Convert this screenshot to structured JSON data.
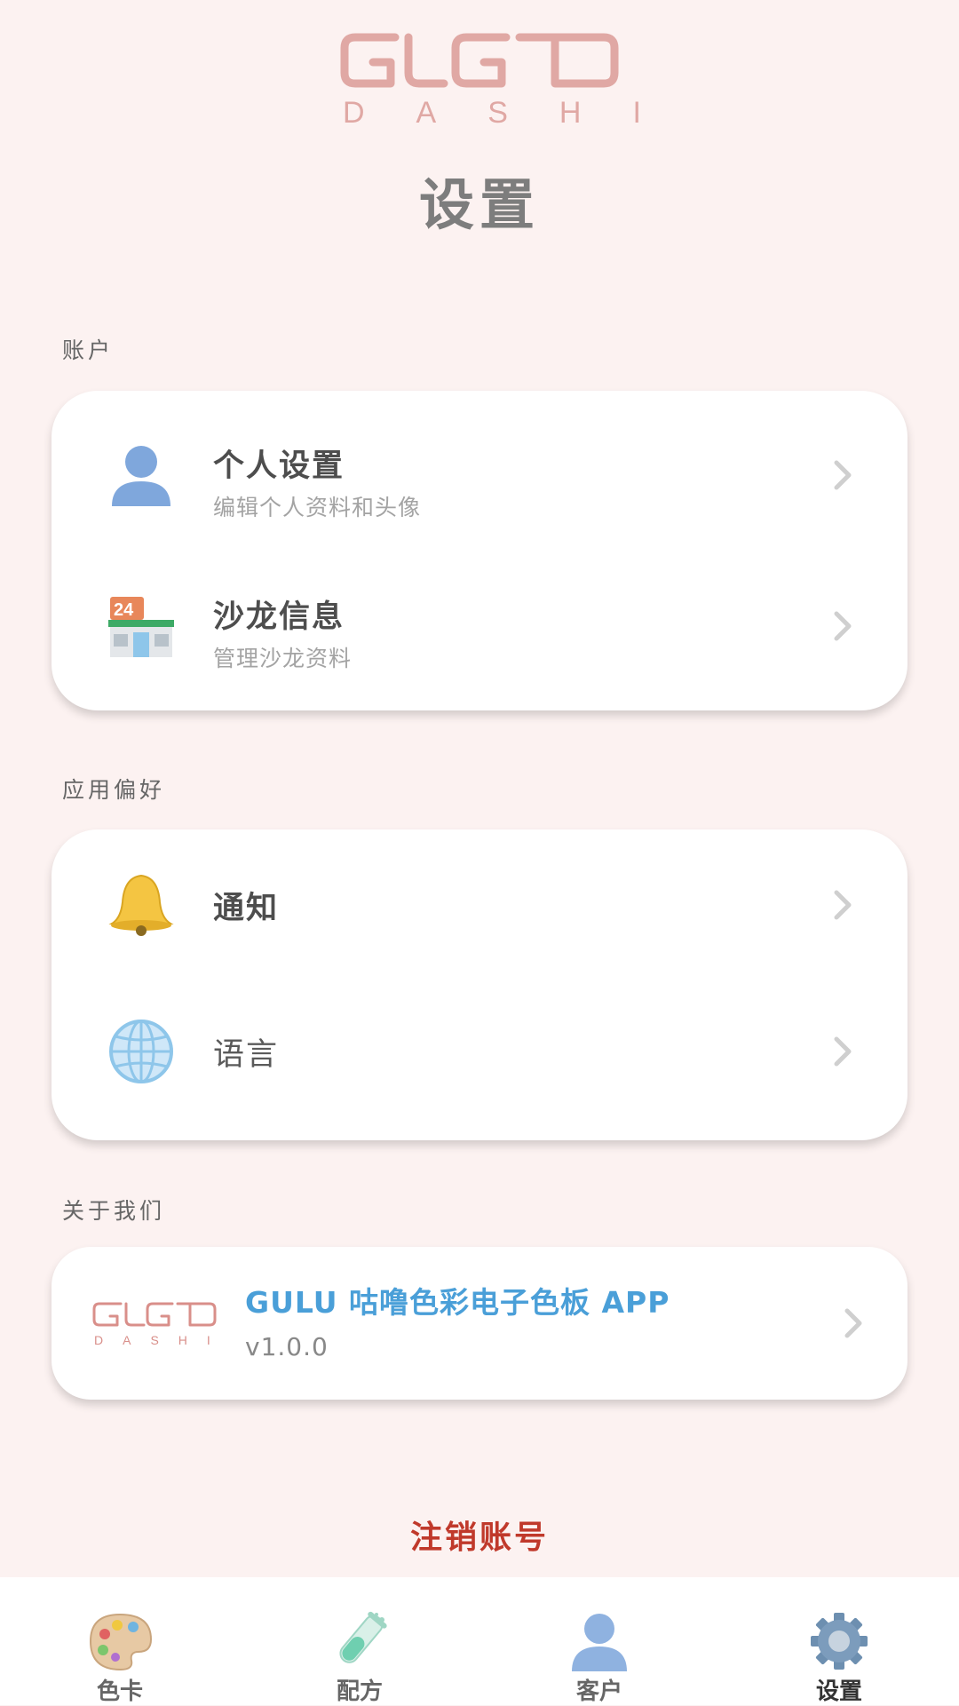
{
  "app": {
    "logo_text": "GULU",
    "logo_subtext": "DASHI",
    "page_title": "设置",
    "brand_color": "#e0a8a4"
  },
  "sections": [
    {
      "label": "账户",
      "items": [
        {
          "title": "个人设置",
          "subtitle": "编辑个人资料和头像",
          "icon": "person-icon"
        },
        {
          "title": "沙龙信息",
          "subtitle": "管理沙龙资料",
          "icon": "store-24-icon"
        }
      ]
    },
    {
      "label": "应用偏好",
      "items": [
        {
          "title": "通知",
          "icon": "bell-icon"
        },
        {
          "title": "语言",
          "icon": "globe-icon"
        }
      ]
    },
    {
      "label": "关于我们",
      "items": [
        {
          "title": "GULU 咕噜色彩电子色板 APP",
          "subtitle": "v1.0.0",
          "icon": "gulu-logo-icon",
          "title_color": "#4a9fd8"
        }
      ]
    }
  ],
  "logout_label": "注销账号",
  "logout_color": "#c0392b",
  "tabbar": [
    {
      "label": "色卡",
      "icon": "palette-icon"
    },
    {
      "label": "配方",
      "icon": "test-tube-icon"
    },
    {
      "label": "客户",
      "icon": "person-icon"
    },
    {
      "label": "设置",
      "icon": "gear-icon",
      "active": true
    }
  ]
}
